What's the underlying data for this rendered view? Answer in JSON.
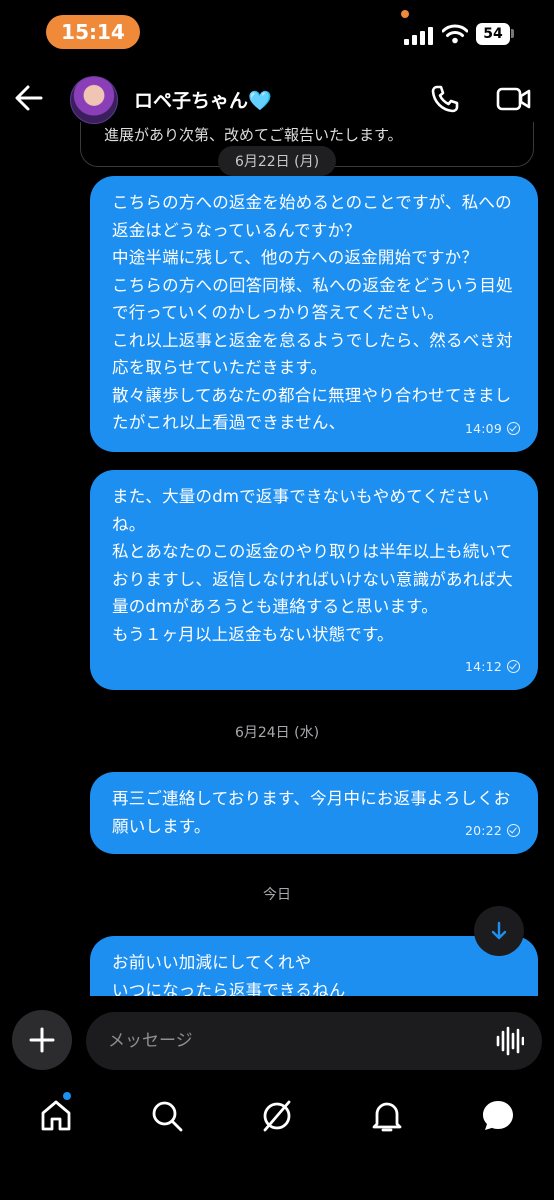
{
  "status_bar": {
    "time": "15:14",
    "battery": "54"
  },
  "header": {
    "contact_name": "ロペ子ちゃん🩵"
  },
  "previous_message": {
    "text": "進展があり次第、改めてご報告いたします。"
  },
  "dates": {
    "first": "6月22日 (月)",
    "second": "6月24日 (水)",
    "third": "今日"
  },
  "messages": [
    {
      "text": "こちらの方への返金を始めるとのことですが、私への返金はどうなっているんですか？\n中途半端に残して、他の方への返金開始ですか？\nこちらの方への回答同様、私への返金をどういう目処で行っていくのかしっかり答えてください。\nこれ以上返事と返金を怠るようでしたら、然るべき対応を取らせていただきます。\n散々譲歩してあなたの都合に無理やり合わせてきましたがこれ以上看過できません、",
      "time": "14:09"
    },
    {
      "text": "また、大量のdmで返事できないもやめてくださいね。\n私とあなたのこの返金のやり取りは半年以上も続いておりますし、返信しなければいけない意識があれば大量のdmがあろうとも連絡すると思います。\nもう１ヶ月以上返金もない状態です。",
      "time": "14:12"
    },
    {
      "text": "再三ご連絡しております、今月中にお返事よろしくお願いします。",
      "time": "20:22"
    },
    {
      "text": "お前いい加減にしてくれや\nいつになったら返事できるねん"
    }
  ],
  "composer": {
    "placeholder": "メッセージ"
  },
  "icons": {
    "back": "arrow-left-icon",
    "call": "phone-icon",
    "video": "video-camera-icon",
    "plus": "plus-icon",
    "mic": "voice-wave-icon",
    "scroll": "arrow-down-icon",
    "home": "home-icon",
    "search": "search-icon",
    "explore": "compass-icon",
    "notifications": "bell-icon",
    "messages": "chat-bubble-icon"
  },
  "colors": {
    "bubble": "#1d8ff1",
    "time_pill": "#ef8a3a",
    "background": "#000000"
  }
}
